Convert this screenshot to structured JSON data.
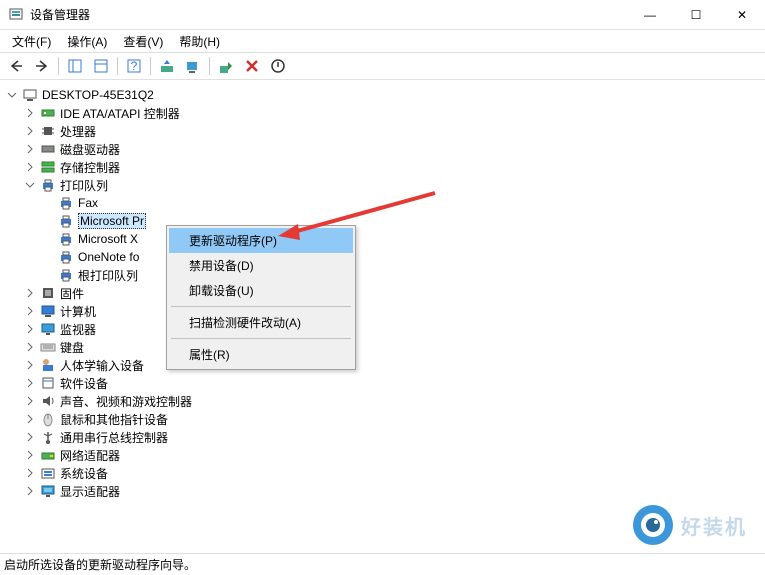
{
  "window": {
    "title": "设备管理器",
    "controls": {
      "min": "—",
      "max": "☐",
      "close": "✕"
    }
  },
  "menubar": {
    "items": [
      "文件(F)",
      "操作(A)",
      "查看(V)",
      "帮助(H)"
    ]
  },
  "tree": {
    "root": "DESKTOP-45E31Q2",
    "nodes": [
      {
        "label": "IDE ATA/ATAPI 控制器",
        "icon": "controller",
        "expanded": false
      },
      {
        "label": "处理器",
        "icon": "cpu",
        "expanded": false
      },
      {
        "label": "磁盘驱动器",
        "icon": "disk",
        "expanded": false
      },
      {
        "label": "存储控制器",
        "icon": "storage",
        "expanded": false
      },
      {
        "label": "打印队列",
        "icon": "printer",
        "expanded": true,
        "children": [
          {
            "label": "Fax",
            "icon": "printer"
          },
          {
            "label": "Microsoft Pr",
            "icon": "printer",
            "selected": true
          },
          {
            "label": "Microsoft X",
            "icon": "printer"
          },
          {
            "label": "OneNote fo",
            "icon": "printer"
          },
          {
            "label": "根打印队列",
            "icon": "printer"
          }
        ]
      },
      {
        "label": "固件",
        "icon": "firmware",
        "expanded": false
      },
      {
        "label": "计算机",
        "icon": "computer",
        "expanded": false
      },
      {
        "label": "监视器",
        "icon": "monitor",
        "expanded": false
      },
      {
        "label": "键盘",
        "icon": "keyboard",
        "expanded": false
      },
      {
        "label": "人体学输入设备",
        "icon": "hid",
        "expanded": false
      },
      {
        "label": "软件设备",
        "icon": "software",
        "expanded": false
      },
      {
        "label": "声音、视频和游戏控制器",
        "icon": "audio",
        "expanded": false
      },
      {
        "label": "鼠标和其他指针设备",
        "icon": "mouse",
        "expanded": false
      },
      {
        "label": "通用串行总线控制器",
        "icon": "usb",
        "expanded": false
      },
      {
        "label": "网络适配器",
        "icon": "network",
        "expanded": false
      },
      {
        "label": "系统设备",
        "icon": "system",
        "expanded": false
      },
      {
        "label": "显示适配器",
        "icon": "display",
        "expanded": false
      }
    ]
  },
  "context_menu": {
    "items": [
      {
        "label": "更新驱动程序(P)",
        "highlight": true
      },
      {
        "label": "禁用设备(D)"
      },
      {
        "label": "卸载设备(U)"
      },
      {
        "sep": true
      },
      {
        "label": "扫描检测硬件改动(A)"
      },
      {
        "sep": true
      },
      {
        "label": "属性(R)"
      }
    ]
  },
  "statusbar": {
    "text": "启动所选设备的更新驱动程序向导。"
  },
  "watermark": {
    "text": "好装机"
  }
}
